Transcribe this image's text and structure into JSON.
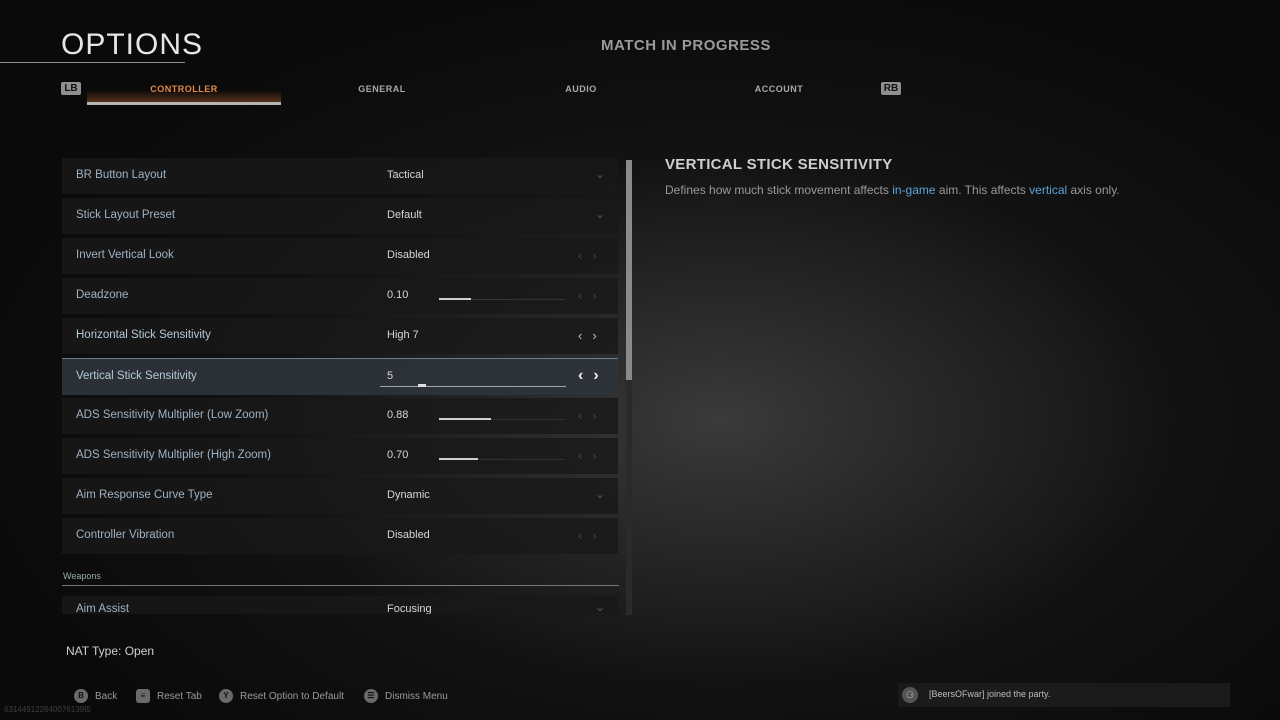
{
  "header": {
    "title": "OPTIONS",
    "status": "MATCH IN PROGRESS",
    "lb": "LB",
    "rb": "RB",
    "tabs": [
      "CONTROLLER",
      "GENERAL",
      "AUDIO",
      "ACCOUNT"
    ]
  },
  "settings": [
    {
      "label": "BR Button Layout",
      "value": "Tactical",
      "control": "dropdown"
    },
    {
      "label": "Stick Layout Preset",
      "value": "Default",
      "control": "dropdown"
    },
    {
      "label": "Invert Vertical Look",
      "value": "Disabled",
      "control": "arrows"
    },
    {
      "label": "Deadzone",
      "value": "0.10",
      "control": "slider",
      "fill": 0.25
    },
    {
      "label": "Horizontal Stick Sensitivity",
      "value": "High 7",
      "control": "arrows"
    },
    {
      "label": "Vertical Stick Sensitivity",
      "value": "5",
      "control": "slider-selected",
      "fill": 0.2
    },
    {
      "label": "ADS Sensitivity Multiplier (Low Zoom)",
      "value": "0.88",
      "control": "slider",
      "fill": 0.41
    },
    {
      "label": "ADS Sensitivity Multiplier (High Zoom)",
      "value": "0.70",
      "control": "slider",
      "fill": 0.31
    },
    {
      "label": "Aim Response Curve Type",
      "value": "Dynamic",
      "control": "dropdown"
    },
    {
      "label": "Controller Vibration",
      "value": "Disabled",
      "control": "arrows"
    }
  ],
  "section": {
    "label": "Weapons",
    "first_row": {
      "label": "Aim Assist",
      "value": "Focusing"
    }
  },
  "description": {
    "title": "VERTICAL STICK SENSITIVITY",
    "text_1": "Defines how much stick movement affects ",
    "kw_1": "in-game",
    "text_2": " aim. This affects ",
    "kw_2": "vertical",
    "text_3": " axis only."
  },
  "footer": {
    "nat": "NAT Type: Open",
    "hints": [
      {
        "btn": "B",
        "label": "Back"
      },
      {
        "btn": "≡",
        "label": "Reset Tab"
      },
      {
        "btn": "Y",
        "label": "Reset Option to Default"
      },
      {
        "btn": "☰",
        "label": "Dismiss Menu"
      }
    ],
    "party": "[BeersOFwar] joined the party.",
    "id": "631449122640076139I5"
  },
  "colors": {
    "accent": "#e08a48",
    "keyword": "#5aa3d8"
  }
}
